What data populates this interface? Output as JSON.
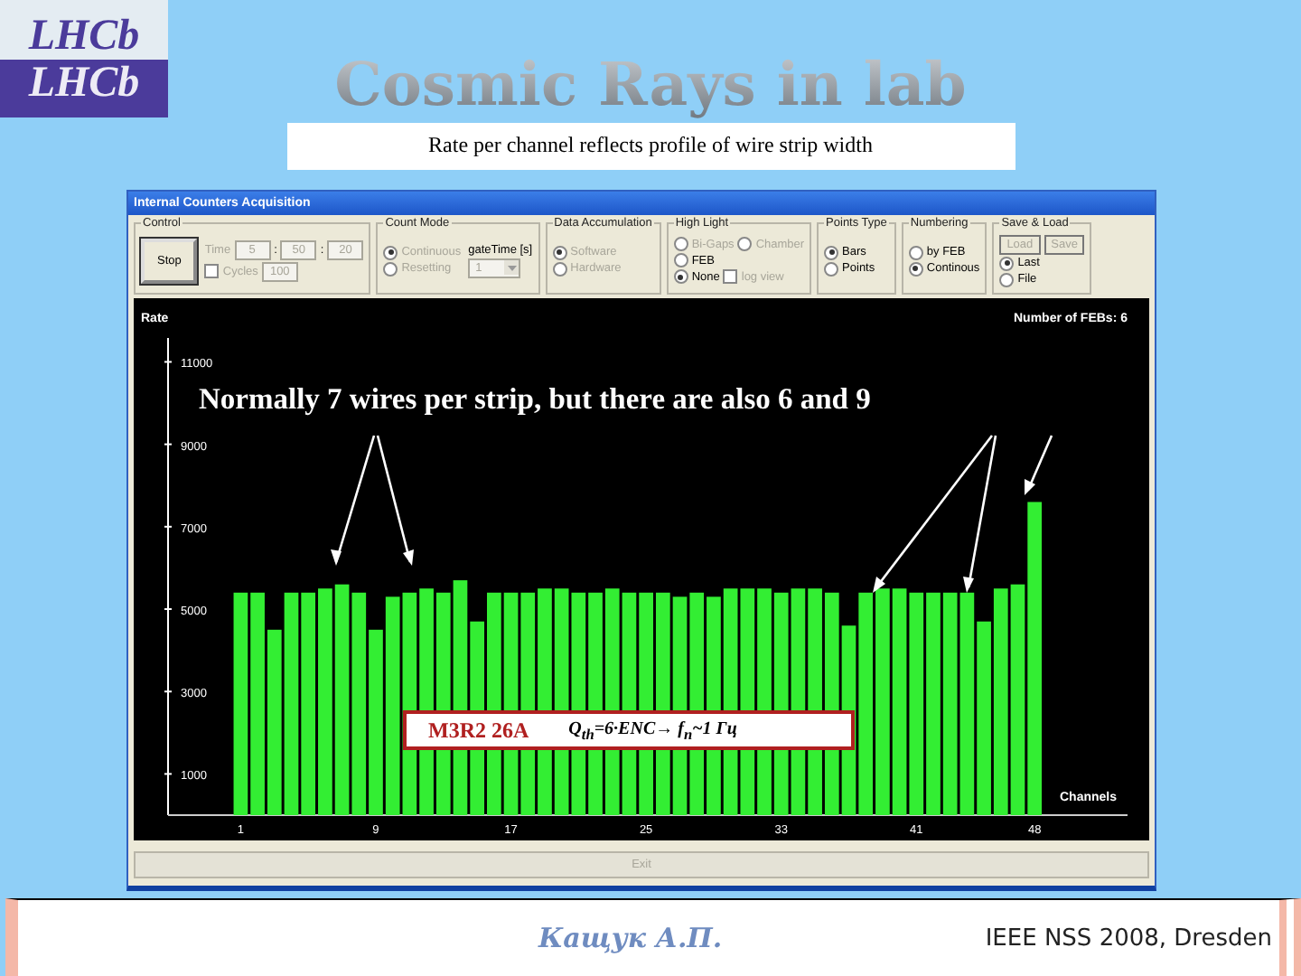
{
  "slide": {
    "logo": "LHCb",
    "logo_reflection": "LHCb",
    "title": "Cosmic Rays in lab",
    "subtitle": "Rate per channel reflects profile of wire strip width"
  },
  "window": {
    "title": "Internal Counters Acquisition"
  },
  "groups": [
    {
      "title": "Control",
      "columns": [
        [
          [
            {
              "kind": "button",
              "label": "Stop",
              "disabled": false
            }
          ]
        ],
        [
          [
            {
              "kind": "label",
              "text": "Time",
              "disabled": true
            },
            {
              "kind": "field",
              "value": "5",
              "disabled": true
            },
            {
              "kind": "label",
              "text": ":",
              "disabled": false
            },
            {
              "kind": "field",
              "value": "50",
              "disabled": true
            },
            {
              "kind": "label",
              "text": ":",
              "disabled": false
            },
            {
              "kind": "field",
              "value": "20",
              "disabled": true
            }
          ],
          [
            {
              "kind": "checkbox",
              "label": "Cycles",
              "checked": false,
              "disabled": true
            },
            {
              "kind": "field",
              "value": "100",
              "disabled": true
            }
          ]
        ]
      ]
    },
    {
      "title": "Count Mode",
      "columns": [
        [
          [
            {
              "kind": "radio",
              "label": "Continuous",
              "selected": true,
              "disabled": true
            }
          ],
          [
            {
              "kind": "radio",
              "label": "Resetting",
              "selected": false,
              "disabled": true
            }
          ]
        ],
        [
          [
            {
              "kind": "label",
              "text": "gateTime [s]",
              "disabled": false
            }
          ],
          [
            {
              "kind": "dropdown",
              "value": "1",
              "disabled": true
            }
          ]
        ]
      ]
    },
    {
      "title": "Data Accumulation",
      "columns": [
        [
          [
            {
              "kind": "radio",
              "label": "Software",
              "selected": true,
              "disabled": true
            }
          ],
          [
            {
              "kind": "radio",
              "label": "Hardware",
              "selected": false,
              "disabled": true
            }
          ]
        ]
      ]
    },
    {
      "title": "High Light",
      "columns": [
        [
          [
            {
              "kind": "radio",
              "label": "Bi-Gaps",
              "selected": false,
              "disabled": true
            },
            {
              "kind": "radio",
              "label": "Chamber",
              "selected": false,
              "disabled": true
            }
          ],
          [
            {
              "kind": "radio",
              "label": "FEB",
              "selected": false,
              "disabled": false
            }
          ],
          [
            {
              "kind": "radio",
              "label": "None",
              "selected": true,
              "disabled": false
            },
            {
              "kind": "checkbox",
              "label": "log view",
              "checked": false,
              "disabled": true
            }
          ]
        ]
      ]
    },
    {
      "title": "Points Type",
      "columns": [
        [
          [
            {
              "kind": "radio",
              "label": "Bars",
              "selected": true,
              "disabled": false
            }
          ],
          [
            {
              "kind": "radio",
              "label": "Points",
              "selected": false,
              "disabled": false
            }
          ]
        ]
      ]
    },
    {
      "title": "Numbering",
      "columns": [
        [
          [
            {
              "kind": "radio",
              "label": "by FEB",
              "selected": false,
              "disabled": false
            }
          ],
          [
            {
              "kind": "radio",
              "label": "Continous",
              "selected": true,
              "disabled": false
            }
          ]
        ]
      ]
    },
    {
      "title": "Save & Load",
      "columns": [
        [
          [
            {
              "kind": "button",
              "label": "Load",
              "disabled": true
            },
            {
              "kind": "button",
              "label": "Save",
              "disabled": true
            }
          ],
          [
            {
              "kind": "radio",
              "label": "Last",
              "selected": true,
              "disabled": false
            }
          ],
          [
            {
              "kind": "radio",
              "label": "File",
              "selected": false,
              "disabled": false
            }
          ]
        ]
      ]
    }
  ],
  "plot": {
    "feb_count": "Number of FEBs:  6",
    "chart_data": {
      "type": "bar",
      "ylabel": "Rate",
      "xlabel": "Channels",
      "x": [
        1,
        2,
        3,
        4,
        5,
        6,
        7,
        8,
        9,
        10,
        11,
        12,
        13,
        14,
        15,
        16,
        17,
        18,
        19,
        20,
        21,
        22,
        23,
        24,
        25,
        26,
        27,
        28,
        29,
        30,
        31,
        32,
        33,
        34,
        35,
        36,
        37,
        38,
        39,
        40,
        41,
        42,
        43,
        44,
        45,
        46,
        47,
        48
      ],
      "values": [
        5400,
        5400,
        4500,
        5400,
        5400,
        5500,
        5600,
        5400,
        4500,
        5300,
        5400,
        5500,
        5400,
        5700,
        4700,
        5400,
        5400,
        5400,
        5500,
        5500,
        5400,
        5400,
        5500,
        5400,
        5400,
        5400,
        5300,
        5400,
        5300,
        5500,
        5500,
        5500,
        5400,
        5500,
        5500,
        5400,
        4600,
        5400,
        5500,
        5500,
        5400,
        5400,
        5400,
        5400,
        4700,
        5500,
        5600,
        7600
      ],
      "xlim": [
        -3.3,
        53.5
      ],
      "ylim": [
        0,
        11580
      ],
      "xticks": [
        1,
        9,
        17,
        25,
        33,
        41,
        48
      ],
      "yticks": [
        1000,
        3000,
        5000,
        7000,
        9000,
        11000
      ]
    },
    "annotation": "Normally 7 wires per strip, but there are also 6 and 9",
    "label_box": {
      "chamber": "M3R2 26A",
      "formula": "Q$_{th}$=6·ENC→  f$_{n}$~1 Гц"
    }
  },
  "exit_button": {
    "label": "Exit",
    "disabled": true
  },
  "footer": {
    "author": "Кащук А.П.",
    "conference": "IEEE NSS 2008,  Dresden"
  }
}
